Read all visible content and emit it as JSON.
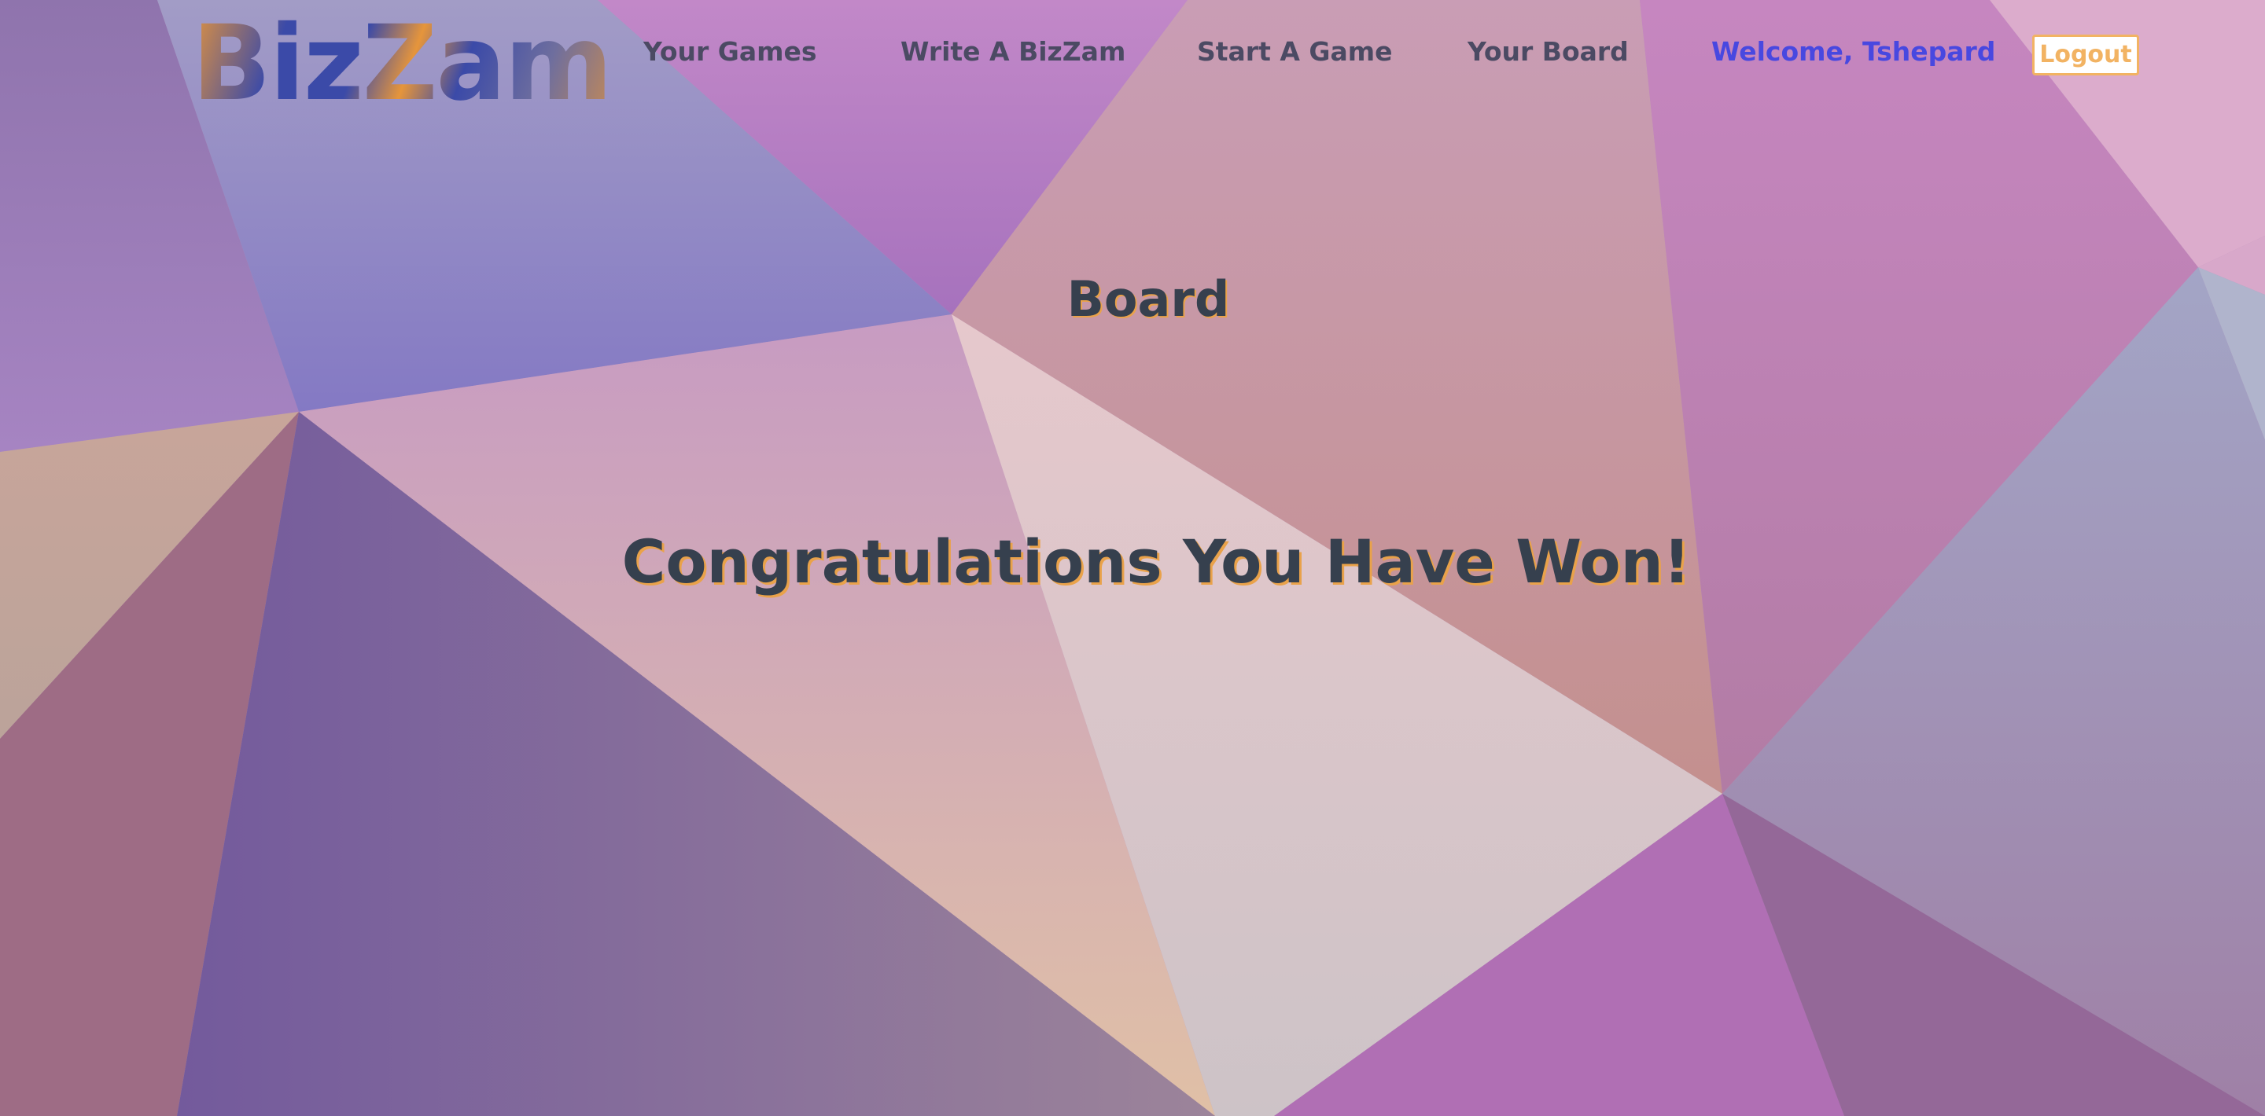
{
  "header": {
    "logo": "BizZam",
    "nav": [
      {
        "label": "Your Games"
      },
      {
        "label": "Write A BizZam"
      },
      {
        "label": "Start A Game"
      },
      {
        "label": "Your Board"
      }
    ],
    "welcome": "Welcome, Tshepard",
    "logout_label": "Logout"
  },
  "main": {
    "title": "Board",
    "message": "Congratulations You Have Won!"
  },
  "colors": {
    "text_dark": "#36404e",
    "nav_text": "#4b4a63",
    "welcome_link": "#4848e0",
    "accent_orange": "#e9a24a",
    "logout_border": "#f2b363"
  }
}
